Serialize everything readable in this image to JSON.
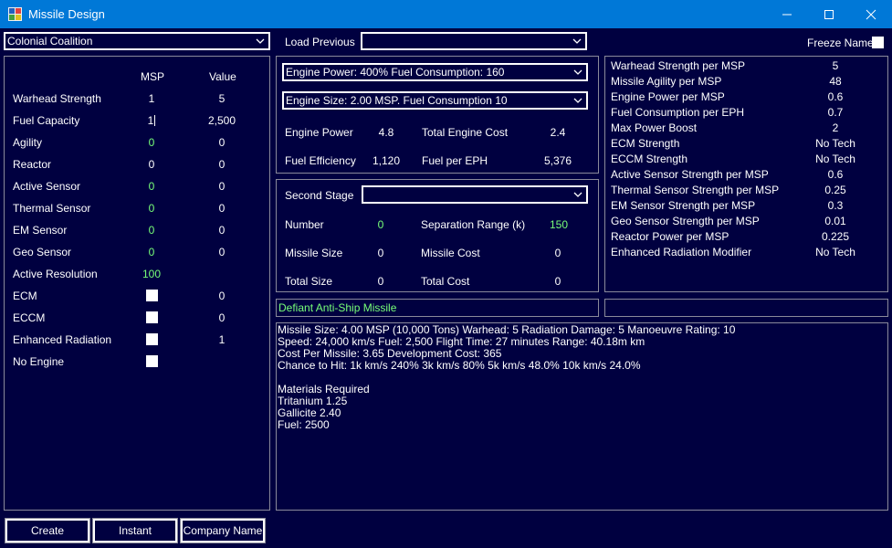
{
  "window": {
    "title": "Missile Design",
    "icon": "app-icon"
  },
  "race_select": {
    "value": "Colonial Coalition"
  },
  "load_previous": {
    "label": "Load Previous",
    "value": ""
  },
  "freeze_name": {
    "label": "Freeze Name",
    "checked": false
  },
  "components": {
    "header_msp": "MSP",
    "header_value": "Value",
    "rows": [
      {
        "label": "Warhead Strength",
        "msp": "1",
        "value": "5",
        "msp_color": "white"
      },
      {
        "label": "Fuel Capacity",
        "msp": "1",
        "value": "2,500",
        "msp_color": "white",
        "editing": true
      },
      {
        "label": "Agility",
        "msp": "0",
        "value": "0",
        "msp_color": "green"
      },
      {
        "label": "Reactor",
        "msp": "0",
        "value": "0",
        "msp_color": "white"
      },
      {
        "label": "Active Sensor",
        "msp": "0",
        "value": "0",
        "msp_color": "green"
      },
      {
        "label": "Thermal Sensor",
        "msp": "0",
        "value": "0",
        "msp_color": "green"
      },
      {
        "label": "EM Sensor",
        "msp": "0",
        "value": "0",
        "msp_color": "green"
      },
      {
        "label": "Geo Sensor",
        "msp": "0",
        "value": "0",
        "msp_color": "green"
      },
      {
        "label": "Active Resolution",
        "msp": "100",
        "value": "",
        "msp_color": "green"
      }
    ],
    "checkbox_rows": [
      {
        "label": "ECM",
        "checked": false,
        "value": "0"
      },
      {
        "label": "ECCM",
        "checked": false,
        "value": "0"
      },
      {
        "label": "Enhanced Radiation",
        "checked": false,
        "value": "1"
      },
      {
        "label": "No Engine",
        "checked": false,
        "value": ""
      }
    ]
  },
  "engine": {
    "power_select": "Engine Power: 400%    Fuel Consumption: 160",
    "size_select": "Engine Size: 2.00 MSP.   Fuel Consumption 10",
    "engine_power_label": "Engine Power",
    "engine_power_value": "4.8",
    "total_cost_label": "Total Engine Cost",
    "total_cost_value": "2.4",
    "fuel_eff_label": "Fuel Efficiency",
    "fuel_eff_value": "1,120",
    "fuel_per_eph_label": "Fuel per EPH",
    "fuel_per_eph_value": "5,376"
  },
  "second_stage": {
    "label": "Second Stage",
    "value": "",
    "number_label": "Number",
    "number_value": "0",
    "sep_range_label": "Separation Range (k)",
    "sep_range_value": "150",
    "missile_size_label": "Missile Size",
    "missile_size_value": "0",
    "missile_cost_label": "Missile Cost",
    "missile_cost_value": "0",
    "total_size_label": "Total Size",
    "total_size_value": "0",
    "total_cost_label": "Total Cost",
    "total_cost_value": "0"
  },
  "tech": [
    {
      "label": "Warhead Strength per MSP",
      "value": "5"
    },
    {
      "label": "Missile Agility per MSP",
      "value": "48"
    },
    {
      "label": "Engine Power per MSP",
      "value": "0.6"
    },
    {
      "label": "Fuel Consumption per EPH",
      "value": "0.7"
    },
    {
      "label": "Max Power Boost",
      "value": "2"
    },
    {
      "label": "ECM Strength",
      "value": "No Tech"
    },
    {
      "label": "ECCM Strength",
      "value": "No Tech"
    },
    {
      "label": "Active Sensor Strength per MSP",
      "value": "0.6"
    },
    {
      "label": "Thermal Sensor Strength per MSP",
      "value": "0.25"
    },
    {
      "label": "EM Sensor Strength per MSP",
      "value": "0.3"
    },
    {
      "label": "Geo Sensor Strength per MSP",
      "value": "0.01"
    },
    {
      "label": "Reactor Power per MSP",
      "value": "0.225"
    },
    {
      "label": "Enhanced Radiation Modifier",
      "value": "No Tech"
    }
  ],
  "missile_name": "Defiant Anti-Ship Missile",
  "summary_lines": [
    "Missile Size: 4.00 MSP  (10,000 Tons)     Warhead: 5    Radiation Damage: 5    Manoeuvre Rating: 10",
    "Speed: 24,000 km/s     Fuel: 2,500     Flight Time: 27 minutes     Range: 40.18m km",
    "Cost Per Missile: 3.65     Development Cost: 365",
    "Chance to Hit: 1k km/s 240%   3k km/s 80%   5k km/s 48.0%   10k km/s 24.0%",
    "",
    "Materials Required",
    "Tritanium  1.25",
    "Gallicite  2.40",
    "Fuel:  2500"
  ],
  "buttons": {
    "create": "Create",
    "instant": "Instant",
    "company_name": "Company Name"
  },
  "colors": {
    "background": "#000040",
    "titlebar": "#0078d7",
    "green": "#78ff78"
  }
}
